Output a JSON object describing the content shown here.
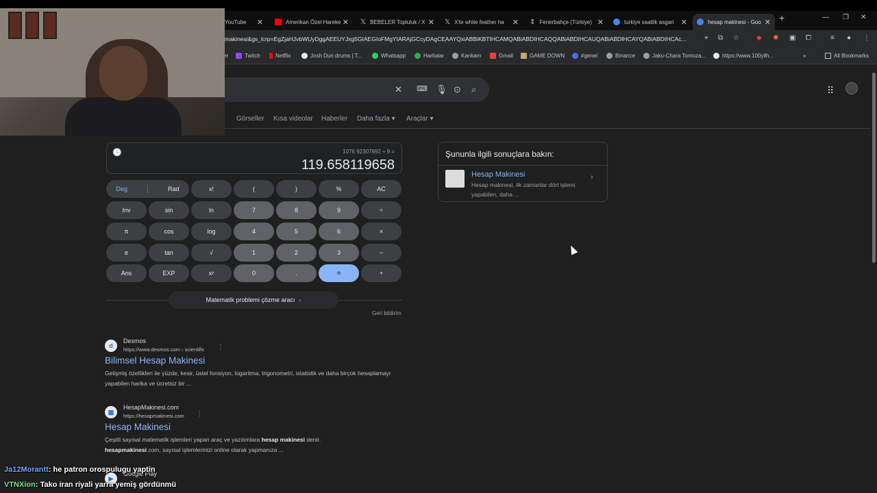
{
  "browser": {
    "tabs": [
      {
        "label": "YouTube",
        "color": "#ff0000"
      },
      {
        "label": "Amerikan Özel Hareke",
        "color": "#ff0000"
      },
      {
        "label": "BEBELER Topluluk / X",
        "color": "#ffffff"
      },
      {
        "label": "X'te white feather ha",
        "color": "#ffffff"
      },
      {
        "label": "Fenerbahçe (Türkiye)",
        "color": "#c4c7c5"
      },
      {
        "label": "turkiye saatlik asgari",
        "color": "#4285f4"
      },
      {
        "label": "hesap makinesi - Goo",
        "color": "#4285f4"
      }
    ],
    "url": "makinesi&gs_lcrp=EgZjaHJvbWUyDggAEEUYJxg5GIAEGIoFMgYIARAjGCcyDAgCEAAYQxiABBiKBTIHCAMQABiABDIHCAQQABiABDIHCAUQABiABDIHCAYQABiABDIHCAc...",
    "bookmarks": [
      "er",
      "Twitch",
      "Netflix",
      "Josh Dun drums | T...",
      "Whatsapp",
      "Haritalar",
      "Kankam",
      "Gmail",
      "GAME DOWN",
      "#genel",
      "Binance",
      "Jaku-Chara Tomoza...",
      "https://www.100yilh...",
      "All Bookmarks"
    ]
  },
  "search": {
    "tabs": [
      "Görseller",
      "Kısa videolar",
      "Haberler",
      "Daha fazla ▾",
      "Araçlar ▾"
    ]
  },
  "calculator": {
    "expression": "1076 92307692 ÷ 9 =",
    "result": "119.658119658",
    "keys": {
      "deg": "Deg",
      "rad": "Rad",
      "fact": "x!",
      "lparen": "(",
      "rparen": ")",
      "pct": "%",
      "ac": "AC",
      "inv": "Inv",
      "sin": "sin",
      "ln": "ln",
      "k7": "7",
      "k8": "8",
      "k9": "9",
      "div": "÷",
      "pi": "π",
      "cos": "cos",
      "log": "log",
      "k4": "4",
      "k5": "5",
      "k6": "6",
      "mul": "×",
      "e": "e",
      "tan": "tan",
      "sqrt": "√",
      "k1": "1",
      "k2": "2",
      "k3": "3",
      "minus": "−",
      "ans": "Ans",
      "exp": "EXP",
      "pow": "xʸ",
      "k0": "0",
      "dot": ".",
      "eq": "=",
      "plus": "+"
    },
    "solver": "Matematik problemi çözme aracı",
    "feedback": "Geri bildirim"
  },
  "sidebar": {
    "heading": "Şununla ilgili sonuçlara bakın:",
    "item_title": "Hesap Makinesi",
    "item_desc": "Hesap makinesi, ilk zamanlar dört işlemi yapabilen, daha ..."
  },
  "results": [
    {
      "site": "Desmos",
      "cite": "https://www.desmos.com › scientific",
      "title": "Bilimsel Hesap Makinesi",
      "snippet": "Gelişmiş özellikleri ile yüzde, kesir, üstel fonsiyon, logaritma, trigonometri, istatistik ve daha birçok hesaplamayı yapabilen harika ve ücretsiz bir ..."
    },
    {
      "site": "HesapMakinesi.com",
      "cite": "https://hesapmakinesi.com",
      "title": "Hesap Makinesi",
      "snippet_a": "Çeşitli sayısal matematik işlemleri yapan araç ve yazılımlara ",
      "snippet_b": "hesap makinesi",
      "snippet_c": " denir.",
      "snippet_d": "hesapmakinesi",
      "snippet_e": ".com, sayısal işlemlerinizi online olarak yapmanıza ..."
    },
    {
      "site": "Google Play"
    }
  ],
  "chat": [
    {
      "user": "Ja12Morantt",
      "message": ": he patron orospulugu yaptin"
    },
    {
      "user": "VTNXion",
      "message": ": Tako iran riyali yarra yemiş gördünmü"
    }
  ]
}
